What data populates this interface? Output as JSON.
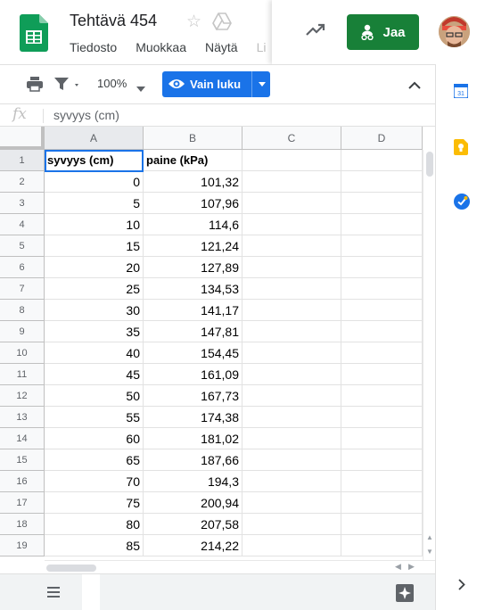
{
  "header": {
    "title": "Tehtävä 454",
    "menu": [
      "Tiedosto",
      "Muokkaa",
      "Näytä",
      "Li"
    ],
    "share_label": "Jaa"
  },
  "toolbar": {
    "zoom": "100%",
    "mode_label": "Vain luku"
  },
  "formula_bar": {
    "fx_label": "fx",
    "content": "syvyys (cm)"
  },
  "grid": {
    "columns": [
      "A",
      "B",
      "C",
      "D"
    ],
    "row_numbers": [
      "1",
      "2",
      "3",
      "4",
      "5",
      "6",
      "7",
      "8",
      "9",
      "10",
      "11",
      "12",
      "13",
      "14",
      "15",
      "16",
      "17",
      "18",
      "19"
    ],
    "header_row": [
      "syvyys (cm)",
      "paine (kPa)"
    ],
    "rows": [
      [
        "0",
        "101,32"
      ],
      [
        "5",
        "107,96"
      ],
      [
        "10",
        "114,6"
      ],
      [
        "15",
        "121,24"
      ],
      [
        "20",
        "127,89"
      ],
      [
        "25",
        "134,53"
      ],
      [
        "30",
        "141,17"
      ],
      [
        "35",
        "147,81"
      ],
      [
        "40",
        "154,45"
      ],
      [
        "45",
        "161,09"
      ],
      [
        "50",
        "167,73"
      ],
      [
        "55",
        "174,38"
      ],
      [
        "60",
        "181,02"
      ],
      [
        "65",
        "187,66"
      ],
      [
        "70",
        "194,3"
      ],
      [
        "75",
        "200,94"
      ],
      [
        "80",
        "207,58"
      ],
      [
        "85",
        "214,22"
      ]
    ],
    "selected_cell": "A1"
  },
  "colors": {
    "share_green": "#188038",
    "accent_blue": "#1a73e8",
    "sheets_green": "#0f9d58"
  },
  "icons": [
    "sheets-logo-icon",
    "star-icon",
    "drive-move-icon",
    "trending-icon",
    "share-person-icon",
    "print-icon",
    "filter-icon",
    "eye-icon",
    "chevron-up-icon",
    "calendar-icon",
    "keep-icon",
    "tasks-icon",
    "sheets-list-icon",
    "explore-icon",
    "chevron-right-icon"
  ]
}
